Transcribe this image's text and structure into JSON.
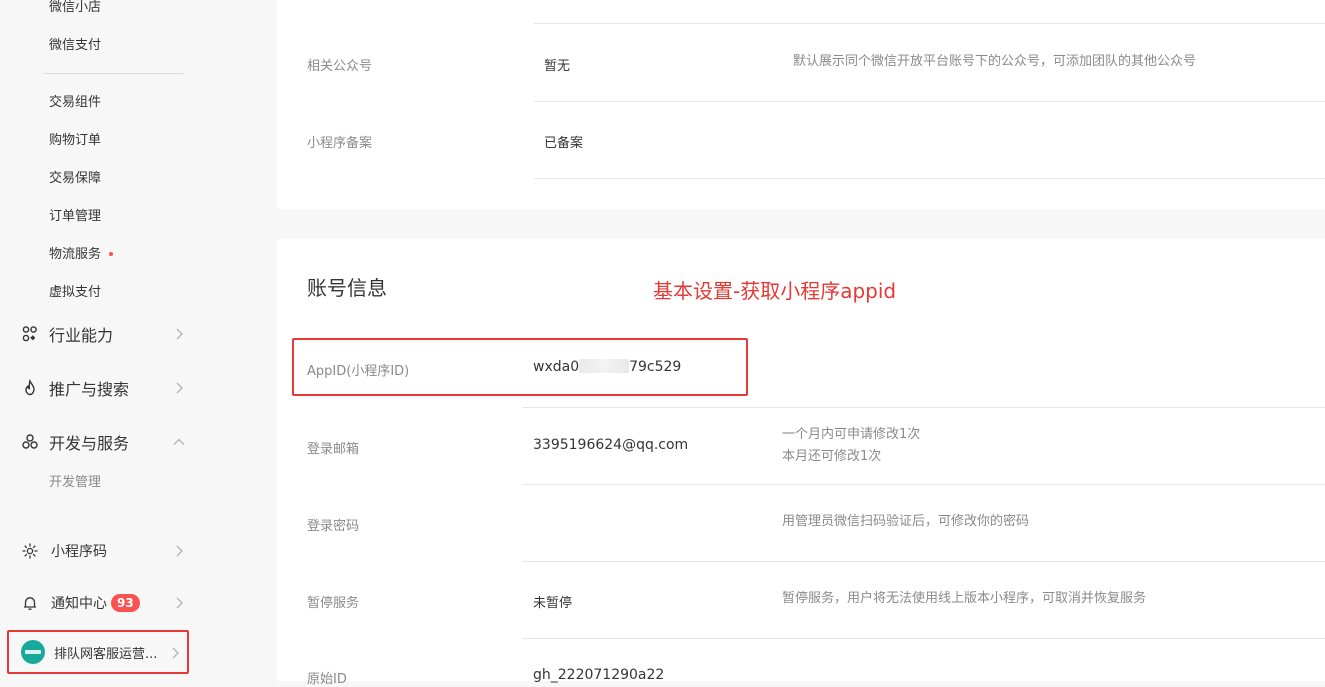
{
  "sidebar": {
    "sub_items": [
      {
        "label": "微信小店"
      },
      {
        "label": "微信支付"
      },
      {
        "label": "交易组件"
      },
      {
        "label": "购物订单"
      },
      {
        "label": "交易保障"
      },
      {
        "label": "订单管理"
      },
      {
        "label": "物流服务"
      },
      {
        "label": "虚拟支付"
      }
    ],
    "groups": [
      {
        "label": "行业能力",
        "icon": "nodes-icon",
        "expanded": false
      },
      {
        "label": "推广与搜索",
        "icon": "flame-icon",
        "expanded": false
      },
      {
        "label": "开发与服务",
        "icon": "flower-icon",
        "expanded": true
      }
    ],
    "dev_sub_item": "开发管理",
    "mini_code": {
      "label": "小程序码",
      "icon": "sun-icon"
    },
    "notifications": {
      "label": "通知中心",
      "badge": "93",
      "icon": "bell-icon"
    },
    "account": {
      "name": "排队网客服运营..."
    }
  },
  "card1": {
    "rows": [
      {
        "label": "相关公众号",
        "value": "暂无",
        "desc": "默认展示同个微信开放平台账号下的公众号，可添加团队的其他公众号"
      },
      {
        "label": "小程序备案",
        "value": "已备案",
        "desc": ""
      }
    ]
  },
  "card2": {
    "title": "账号信息",
    "annotation": "基本设置-获取小程序appid",
    "appid": {
      "label": "AppID(小程序ID)",
      "value_prefix": "wxda0",
      "value_suffix": "79c529"
    },
    "rows": [
      {
        "label": "登录邮箱",
        "value": "3395196624@qq.com",
        "desc1": "一个月内可申请修改1次",
        "desc2": "本月还可修改1次"
      },
      {
        "label": "登录密码",
        "value": "",
        "desc1": "用管理员微信扫码验证后，可修改你的密码"
      },
      {
        "label": "暂停服务",
        "value": "未暂停",
        "desc1": "暂停服务，用户将无法使用线上版本小程序，可取消并恢复服务"
      },
      {
        "label": "原始ID",
        "value": "gh_222071290a22"
      }
    ]
  },
  "colors": {
    "accent_red": "#e53935",
    "badge_red": "#fa5151",
    "avatar_teal": "#18a99b"
  }
}
